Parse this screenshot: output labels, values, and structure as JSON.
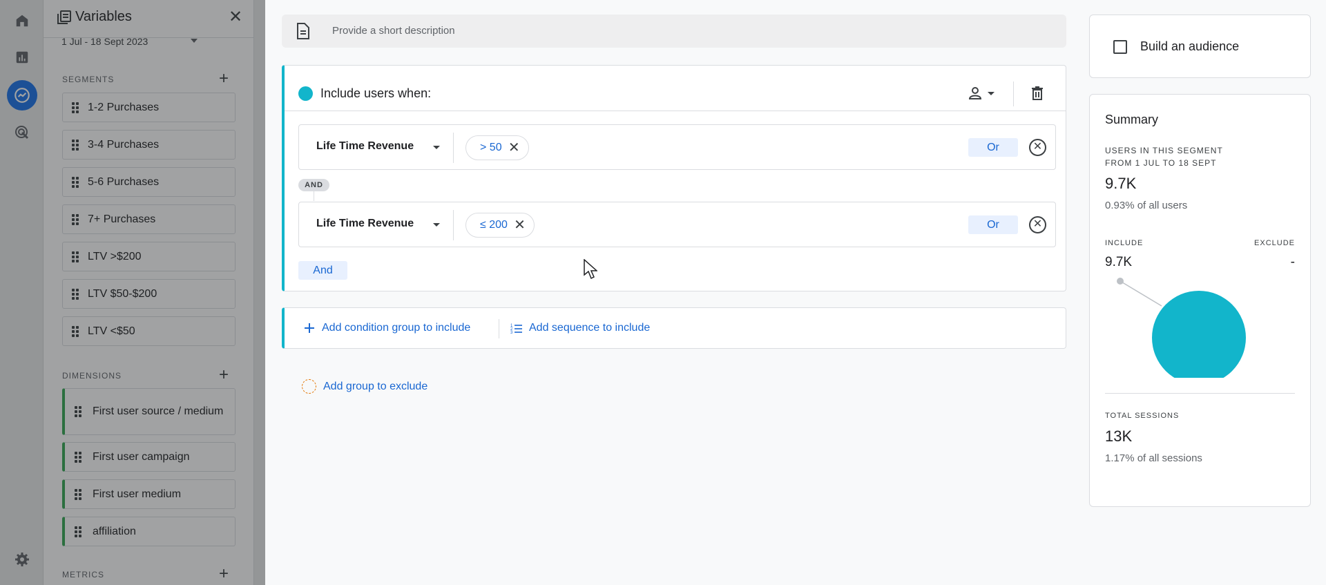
{
  "variables_panel": {
    "title": "Variables",
    "date_range": "1 Jul - 18 Sept 2023",
    "segments_label": "SEGMENTS",
    "segments": [
      "1-2 Purchases",
      "3-4 Purchases",
      "5-6 Purchases",
      "7+ Purchases",
      "LTV >$200",
      "LTV $50-$200",
      "LTV <$50"
    ],
    "dimensions_label": "DIMENSIONS",
    "dimensions": [
      "First user source / medium",
      "First user campaign",
      "First user medium",
      "affiliation"
    ],
    "metrics_label": "METRICS"
  },
  "description": {
    "placeholder": "Provide a short description"
  },
  "include_group": {
    "title": "Include users when:",
    "conditions": [
      {
        "dimension": "Life Time Revenue",
        "value": "> 50",
        "or_label": "Or"
      },
      {
        "dimension": "Life Time Revenue",
        "value": "≤ 200",
        "or_label": "Or"
      }
    ],
    "and_connector": "AND",
    "and_button": "And"
  },
  "add_actions": {
    "condition_group": "Add condition group to include",
    "sequence": "Add sequence to include",
    "exclude": "Add group to exclude"
  },
  "audience": {
    "label": "Build an audience",
    "checked": false
  },
  "summary": {
    "title": "Summary",
    "users_label_1": "USERS IN THIS SEGMENT",
    "users_label_2": "FROM 1 JUL TO 18 SEPT",
    "users_value": "9.7K",
    "users_share": "0.93% of all users",
    "include_label": "INCLUDE",
    "exclude_label": "EXCLUDE",
    "include_value": "9.7K",
    "exclude_value": "-",
    "sessions_label": "TOTAL SESSIONS",
    "sessions_value": "13K",
    "sessions_share": "1.17% of all sessions"
  },
  "colors": {
    "accent": "#12b5cb",
    "link": "#1967d2",
    "nav_active": "#1a73e8",
    "dimension_bar": "#34a853",
    "exclude_dash": "#e37400"
  },
  "icons": [
    "home-icon",
    "bar-chart-icon",
    "explore-icon",
    "advertising-icon",
    "settings-icon",
    "variables-icon",
    "close-icon",
    "description-icon",
    "user-scope-icon",
    "trash-icon",
    "remove-condition-icon",
    "add-icon",
    "sequence-icon"
  ]
}
